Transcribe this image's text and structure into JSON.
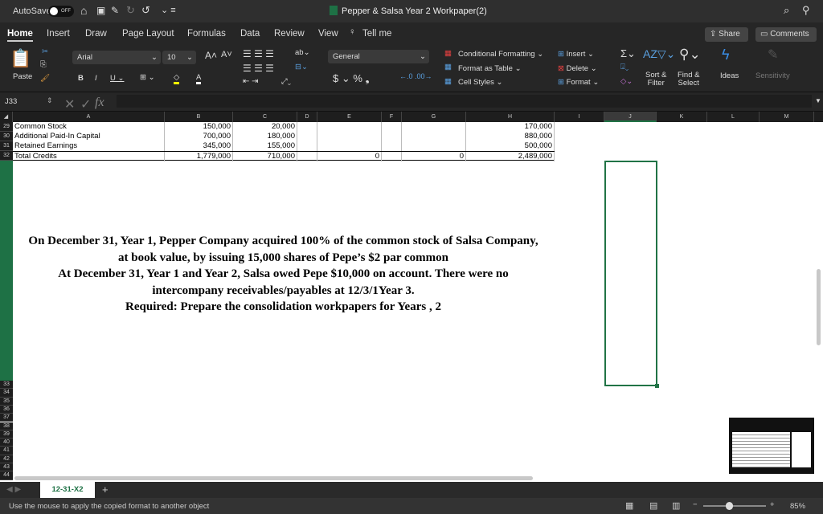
{
  "titlebar": {
    "autosave": "AutoSave",
    "toggle": "OFF",
    "title": "Pepper & Salsa Year 2 Workpaper(2)"
  },
  "tabs": [
    "Home",
    "Insert",
    "Draw",
    "Page Layout",
    "Formulas",
    "Data",
    "Review",
    "View",
    "Tell me"
  ],
  "share": "Share",
  "comments": "Comments",
  "ribbon": {
    "paste": "Paste",
    "font": "Arial",
    "size": "10",
    "number_format": "General",
    "cond_format": "Conditional Formatting",
    "format_table": "Format as Table",
    "cell_styles": "Cell Styles",
    "insert": "Insert",
    "delete": "Delete",
    "format": "Format",
    "sort_filter_1": "Sort &",
    "sort_filter_2": "Filter",
    "find_select_1": "Find &",
    "find_select_2": "Select",
    "ideas": "Ideas",
    "sensitivity": "Sensitivity"
  },
  "formula_bar": {
    "name_box": "J33",
    "fx": "fx",
    "value": ""
  },
  "columns": [
    "A",
    "B",
    "C",
    "D",
    "E",
    "F",
    "G",
    "H",
    "I",
    "J",
    "K",
    "L",
    "M"
  ],
  "rows": [
    {
      "n": "29",
      "a": "Common Stock",
      "b": "150,000",
      "c": "20,000",
      "e": "",
      "g": "",
      "h": "170,000"
    },
    {
      "n": "30",
      "a": "Additional Paid-In Capital",
      "b": "700,000",
      "c": "180,000",
      "e": "",
      "g": "",
      "h": "880,000"
    },
    {
      "n": "31",
      "a": "Retained Earnings",
      "b": "345,000",
      "c": "155,000",
      "e": "",
      "g": "",
      "h": "500,000"
    },
    {
      "n": "32",
      "a": "Total Credits",
      "b": "1,779,000",
      "c": "710,000",
      "e": "0",
      "g": "0",
      "h": "2,489,000"
    }
  ],
  "lower_rows": [
    "33",
    "34",
    "35",
    "36",
    "37",
    "38",
    "39",
    "40",
    "41",
    "42",
    "43",
    "44"
  ],
  "textbox": [
    "On December 31, Year 1, Pepper Company acquired 100% of the common stock of Salsa Company,",
    "at book value, by issuing 15,000 shares of Pepe’s $2 par common",
    "At December 31, Year 1 and Year 2, Salsa owed Pepe $10,000 on account.  There were no",
    "intercompany receivables/payables at 12/3/1Year 3.",
    "Required: Prepare the consolidation workpapers for Years , 2"
  ],
  "sheet_tab": "12-31-X2",
  "add_sheet": "+",
  "status": {
    "message": "Use the mouse to apply the copied format to another object",
    "zoom": "85%",
    "zoom_level_percent": 85
  },
  "colors": {
    "accent": "#1e7145",
    "selection": "#217346"
  }
}
